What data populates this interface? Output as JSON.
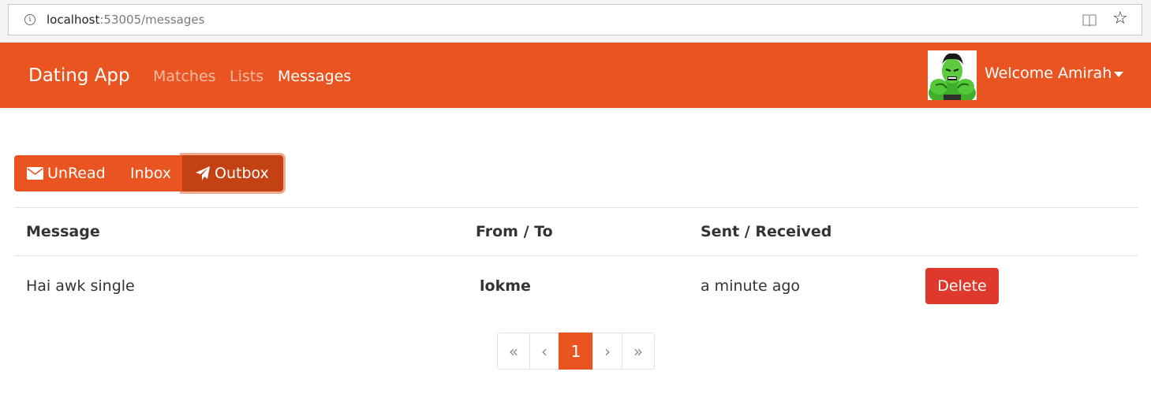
{
  "browser": {
    "url_host": "localhost",
    "url_path": ":53005/messages",
    "info_glyph": "i",
    "star_glyph": "☆"
  },
  "navbar": {
    "brand": "Dating App",
    "links": [
      "Matches",
      "Lists",
      "Messages"
    ],
    "active_link": "Messages",
    "welcome": "Welcome Amirah",
    "background": "#e95420"
  },
  "tabs": {
    "unread": "UnRead",
    "inbox": "Inbox",
    "outbox": "Outbox",
    "active": "Outbox"
  },
  "table": {
    "headers": [
      "Message",
      "From / To",
      "Sent / Received"
    ],
    "rows": [
      {
        "message": "Hai awk single",
        "user": "lokme",
        "sent": "a minute ago",
        "action": "Delete"
      }
    ]
  },
  "pagination": {
    "first": "«",
    "prev": "‹",
    "current": "1",
    "next": "›",
    "last": "»"
  },
  "colors": {
    "accent": "#e95420",
    "accent_active": "#c34113",
    "danger": "#df382c"
  }
}
